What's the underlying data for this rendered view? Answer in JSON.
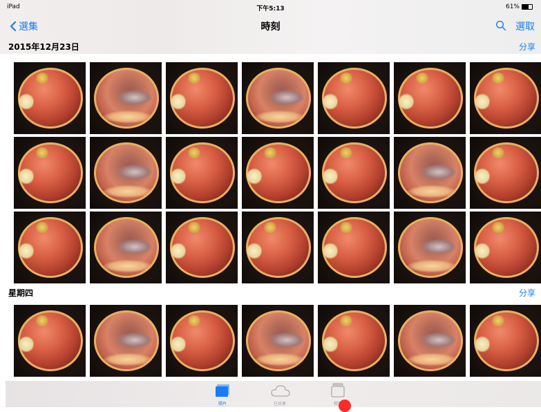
{
  "status_bar": {
    "device": "iPad",
    "time": "下午5:13",
    "battery_percent": "61%",
    "battery_level": 0.61
  },
  "nav": {
    "back_label": "選集",
    "title": "時刻",
    "select_label": "選取",
    "search_icon": "search-icon",
    "back_icon": "chevron-left-icon"
  },
  "sections": [
    {
      "title": "2015年12月23日",
      "share_label": "分享"
    },
    {
      "title": "星期四",
      "share_label": "分享"
    }
  ],
  "tabs": [
    {
      "label": "照片",
      "icon": "photos-icon",
      "active": true
    },
    {
      "label": "已共享",
      "icon": "cloud-icon",
      "active": false
    },
    {
      "label": "相簿",
      "icon": "albums-icon",
      "active": false
    }
  ],
  "colors": {
    "accent": "#1a7cf2",
    "indicator": "#ff2a2a"
  }
}
